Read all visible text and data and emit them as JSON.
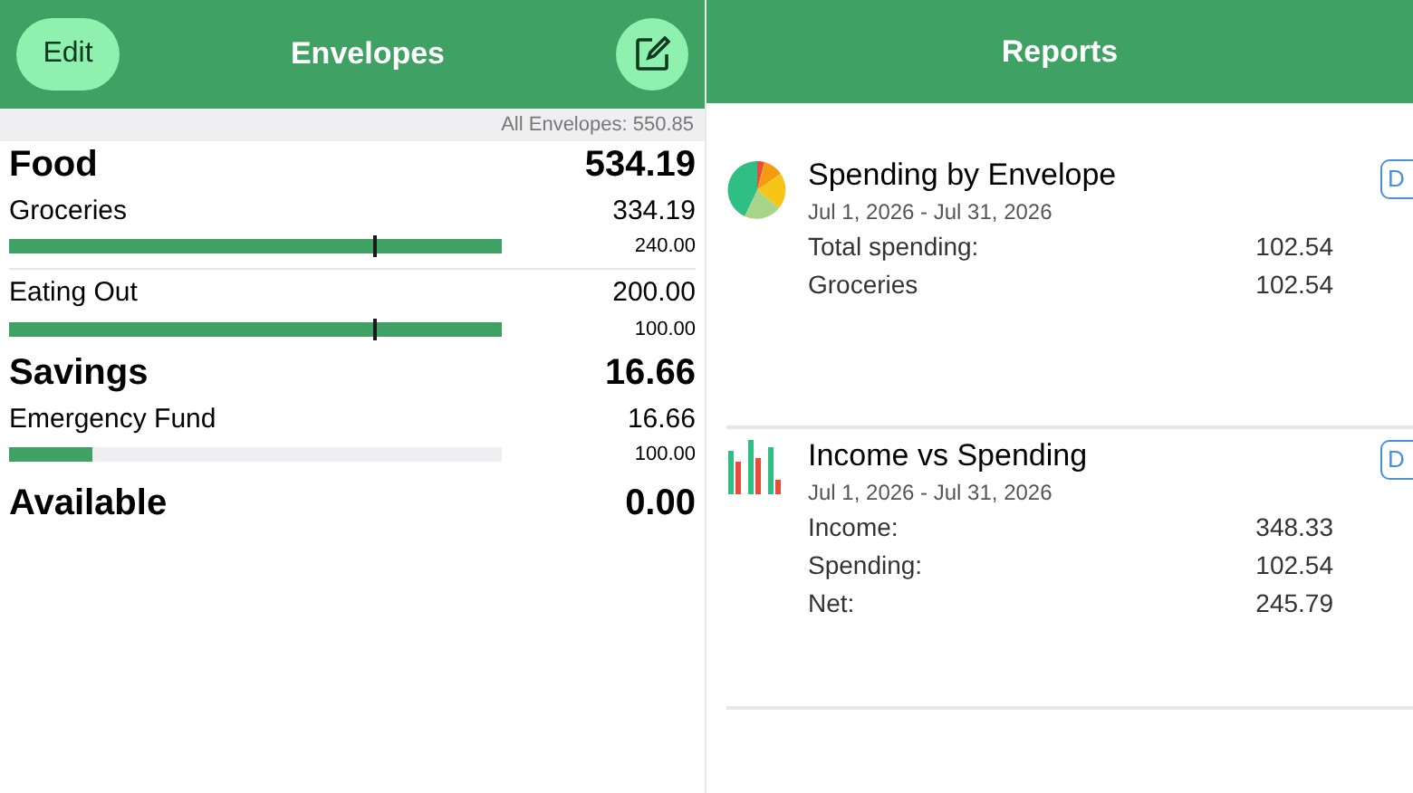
{
  "envelopes_panel": {
    "edit_button": "Edit",
    "title": "Envelopes",
    "total": "All Envelopes: 550.85",
    "groups": [
      {
        "name": "Food",
        "amount": "534.19",
        "envelopes": [
          {
            "name": "Groceries",
            "amount": "334.19",
            "budget": "240.00",
            "level": 1,
            "over_budget": true
          },
          {
            "name": "Eating Out",
            "amount": "200.00",
            "budget": "100.00",
            "level": 1,
            "over_budget": true
          }
        ]
      },
      {
        "name": "Savings",
        "amount": "16.66",
        "envelopes": [
          {
            "name": "Emergency Fund",
            "amount": "16.66",
            "budget": "100.00",
            "level": 0.17,
            "over_budget": false
          }
        ]
      }
    ],
    "available": {
      "label": "Available",
      "amount": "0.00"
    }
  },
  "reports_panel": {
    "title": "Reports",
    "reports": [
      {
        "kind": "pie",
        "title": "Spending by Envelope",
        "dates": "Jul 1, 2026 - Jul 31, 2026",
        "button": "D",
        "lines": [
          {
            "label": "Total spending:",
            "value": "102.54"
          },
          {
            "label": "Groceries",
            "value": "102.54"
          }
        ]
      },
      {
        "kind": "bars",
        "title": "Income vs Spending",
        "dates": "Jul 1, 2026 - Jul 31, 2026",
        "button": "D",
        "lines": [
          {
            "label": "Income:",
            "value": "348.33"
          },
          {
            "label": "Spending:",
            "value": "102.54"
          },
          {
            "label": "Net:",
            "value": "245.79"
          }
        ]
      }
    ]
  }
}
